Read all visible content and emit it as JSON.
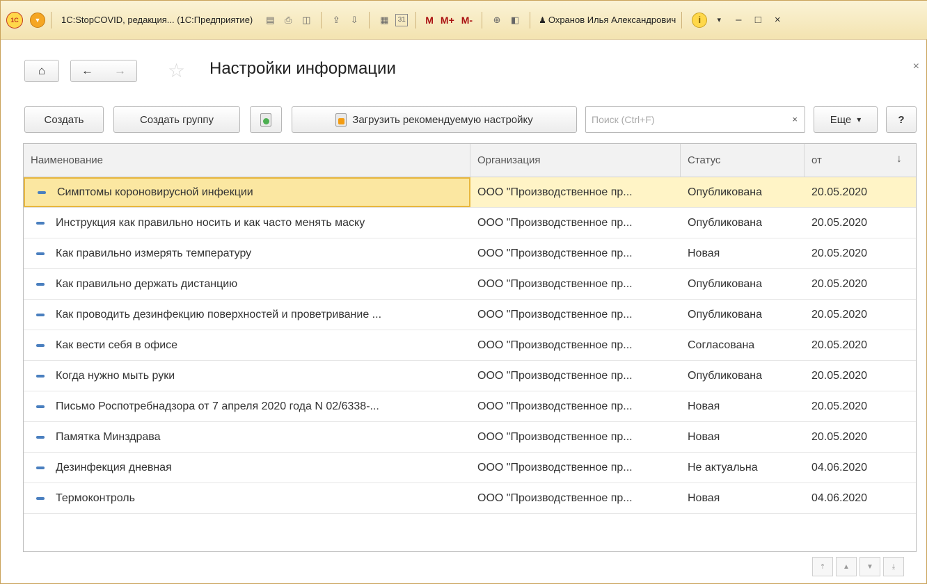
{
  "titlebar": {
    "logo": "1С",
    "title": "1С:StopCOVID, редакция... (1С:Предприятие)",
    "m_buttons": [
      "M",
      "M+",
      "M-"
    ],
    "user": "Охранов Илья Александрович",
    "info": "i",
    "icons": [
      "save-icon",
      "print-icon",
      "preview-icon",
      "upload-icon",
      "download-icon",
      "calculator-icon",
      "calendar-icon",
      "zoom-icon",
      "panel-icon",
      "user-icon"
    ],
    "calendar_day": "31",
    "controls": {
      "minimize": "–",
      "maximize": "□",
      "close": "×"
    }
  },
  "form": {
    "title": "Настройки информации",
    "home_glyph": "⌂",
    "back_glyph": "←",
    "forward_glyph": "→",
    "star_glyph": "☆",
    "close_glyph": "×"
  },
  "toolbar": {
    "create": "Создать",
    "create_group": "Создать группу",
    "load_recommended": "Загрузить рекомендуемую настройку",
    "search_placeholder": "Поиск (Ctrl+F)",
    "search_clear": "×",
    "more": "Еще",
    "more_arrow": "▾",
    "help": "?"
  },
  "table": {
    "columns": [
      "Наименование",
      "Организация",
      "Статус",
      "от"
    ],
    "sort_glyph": "↓",
    "rows": [
      {
        "name": "Симптомы короновирусной инфекции",
        "org": "ООО \"Производственное пр...",
        "status": "Опубликована",
        "date": "20.05.2020"
      },
      {
        "name": "Инструкция как правильно носить и как часто менять маску",
        "org": "ООО \"Производственное пр...",
        "status": "Опубликована",
        "date": "20.05.2020"
      },
      {
        "name": "Как правильно измерять температуру",
        "org": "ООО \"Производственное пр...",
        "status": "Новая",
        "date": "20.05.2020"
      },
      {
        "name": "Как правильно держать дистанцию",
        "org": "ООО \"Производственное пр...",
        "status": "Опубликована",
        "date": "20.05.2020"
      },
      {
        "name": "Как проводить дезинфекцию поверхностей и проветривание ...",
        "org": "ООО \"Производственное пр...",
        "status": "Опубликована",
        "date": "20.05.2020"
      },
      {
        "name": "Как вести себя в офисе",
        "org": "ООО \"Производственное пр...",
        "status": "Согласована",
        "date": "20.05.2020"
      },
      {
        "name": "Когда нужно мыть руки",
        "org": "ООО \"Производственное пр...",
        "status": "Опубликована",
        "date": "20.05.2020"
      },
      {
        "name": "Письмо  Роспотребнадзора от 7 апреля 2020 года N 02/6338-...",
        "org": "ООО \"Производственное пр...",
        "status": "Новая",
        "date": "20.05.2020"
      },
      {
        "name": "Памятка Минздрава",
        "org": "ООО \"Производственное пр...",
        "status": "Новая",
        "date": "20.05.2020"
      },
      {
        "name": "Дезинфекция дневная",
        "org": "ООО \"Производственное пр...",
        "status": "Не актуальна",
        "date": "04.06.2020"
      },
      {
        "name": "Термоконтроль",
        "org": "ООО \"Производственное пр...",
        "status": "Новая",
        "date": "04.06.2020"
      }
    ],
    "selected_row": 0
  },
  "pager": {
    "first": "⤒",
    "prev": "▲",
    "next": "▼",
    "last": "⤓"
  }
}
